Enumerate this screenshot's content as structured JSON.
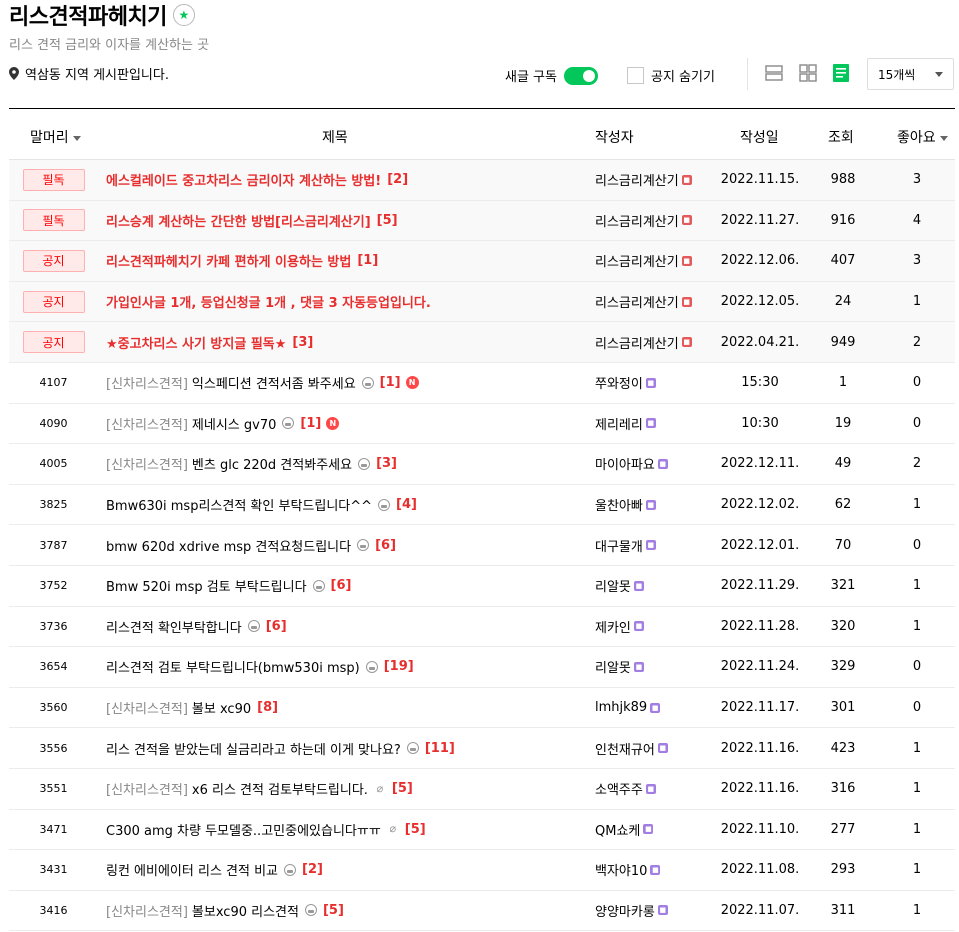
{
  "cafe": {
    "title": "리스견적파헤치기",
    "subtitle": "리스 견적 금리와 이자를 계산하는 곳",
    "location": "역삼동 지역 게시판입니다."
  },
  "controls": {
    "subscribe_label": "새글 구독",
    "hide_notice_label": "공지 숨기기",
    "per_page": "15개씩"
  },
  "columns": {
    "head": "말머리",
    "title": "제목",
    "author": "작성자",
    "date": "작성일",
    "views": "조회",
    "likes": "좋아요"
  },
  "notices": [
    {
      "badge": "필독",
      "title": "에스컬레이드 중고차리스 금리이자 계산하는 방법!",
      "comments": "[2]",
      "author": "리스금리계산기",
      "date": "2022.11.15.",
      "views": "988",
      "likes": "3"
    },
    {
      "badge": "필독",
      "title": "리스승계 계산하는 간단한 방법[리스금리계산기]",
      "comments": "[5]",
      "author": "리스금리계산기",
      "date": "2022.11.27.",
      "views": "916",
      "likes": "4"
    },
    {
      "badge": "공지",
      "title": "리스견적파헤치기 카페 편하게 이용하는 방법",
      "comments": "[1]",
      "author": "리스금리계산기",
      "date": "2022.12.06.",
      "views": "407",
      "likes": "3"
    },
    {
      "badge": "공지",
      "title": "가입인사글 1개, 등업신청글 1개 , 댓글 3 자동등업입니다.",
      "comments": "",
      "author": "리스금리계산기",
      "date": "2022.12.05.",
      "views": "24",
      "likes": "1"
    },
    {
      "badge": "공지",
      "title": "★중고차리스 사기 방지글 필독★",
      "comments": "[3]",
      "author": "리스금리계산기",
      "date": "2022.04.21.",
      "views": "949",
      "likes": "2"
    }
  ],
  "posts": [
    {
      "no": "4107",
      "cat": "[신차리스견적]",
      "title": "익스페디션 견적서좀 봐주세요",
      "icon": "image",
      "comments": "[1]",
      "new": "N",
      "author": "쭈와정이",
      "date": "15:30",
      "views": "1",
      "likes": "0"
    },
    {
      "no": "4090",
      "cat": "[신차리스견적]",
      "title": "제네시스 gv70",
      "icon": "image",
      "comments": "[1]",
      "new": "N",
      "author": "제리레리",
      "date": "10:30",
      "views": "19",
      "likes": "0"
    },
    {
      "no": "4005",
      "cat": "[신차리스견적]",
      "title": "벤츠 glc 220d 견적봐주세요",
      "icon": "image",
      "comments": "[3]",
      "new": "",
      "author": "마이아파요",
      "date": "2022.12.11.",
      "views": "49",
      "likes": "2"
    },
    {
      "no": "3825",
      "cat": "",
      "title": "Bmw630i msp리스견적 확인 부탁드립니다^^",
      "icon": "image",
      "comments": "[4]",
      "new": "",
      "author": "울찬아빠",
      "date": "2022.12.02.",
      "views": "62",
      "likes": "1"
    },
    {
      "no": "3787",
      "cat": "",
      "title": "bmw 620d xdrive msp 견적요청드립니다",
      "icon": "image",
      "comments": "[6]",
      "new": "",
      "author": "대구물개",
      "date": "2022.12.01.",
      "views": "70",
      "likes": "0"
    },
    {
      "no": "3752",
      "cat": "",
      "title": "Bmw 520i msp 검토 부탁드립니다",
      "icon": "image",
      "comments": "[6]",
      "new": "",
      "author": "리알못",
      "date": "2022.11.29.",
      "views": "321",
      "likes": "1"
    },
    {
      "no": "3736",
      "cat": "",
      "title": "리스견적 확인부탁합니다",
      "icon": "image",
      "comments": "[6]",
      "new": "",
      "author": "제카인",
      "date": "2022.11.28.",
      "views": "320",
      "likes": "1"
    },
    {
      "no": "3654",
      "cat": "",
      "title": "리스견적 검토 부탁드립니다(bmw530i msp)",
      "icon": "image",
      "comments": "[19]",
      "new": "",
      "author": "리알못",
      "date": "2022.11.24.",
      "views": "329",
      "likes": "0"
    },
    {
      "no": "3560",
      "cat": "[신차리스견적]",
      "title": "볼보 xc90",
      "icon": "",
      "comments": "[8]",
      "new": "",
      "author": "lmhjk89",
      "date": "2022.11.17.",
      "views": "301",
      "likes": "0"
    },
    {
      "no": "3556",
      "cat": "",
      "title": "리스 견적을 받았는데 실금리라고 하는데 이게 맞나요?",
      "icon": "image",
      "comments": "[11]",
      "new": "",
      "author": "인천재규어",
      "date": "2022.11.16.",
      "views": "423",
      "likes": "1"
    },
    {
      "no": "3551",
      "cat": "[신차리스견적]",
      "title": "x6 리스 견적 검토부탁드립니다.",
      "icon": "clip",
      "comments": "[5]",
      "new": "",
      "author": "소액주주",
      "date": "2022.11.16.",
      "views": "316",
      "likes": "1"
    },
    {
      "no": "3471",
      "cat": "",
      "title": "C300 amg 차량 두모델중..고민중에있습니다ㅠㅠ",
      "icon": "clip",
      "comments": "[5]",
      "new": "",
      "author": "QM쇼케",
      "date": "2022.11.10.",
      "views": "277",
      "likes": "1"
    },
    {
      "no": "3431",
      "cat": "",
      "title": "링컨 에비에이터 리스 견적 비교",
      "icon": "image",
      "comments": "[2]",
      "new": "",
      "author": "백자야10",
      "date": "2022.11.08.",
      "views": "293",
      "likes": "1"
    },
    {
      "no": "3416",
      "cat": "[신차리스견적]",
      "title": "볼보xc90 리스견적",
      "icon": "image",
      "comments": "[5]",
      "new": "",
      "author": "양양마카롱",
      "date": "2022.11.07.",
      "views": "311",
      "likes": "1"
    }
  ],
  "colors": {
    "accent": "#03c75a",
    "notice_text": "#e72e2e"
  }
}
